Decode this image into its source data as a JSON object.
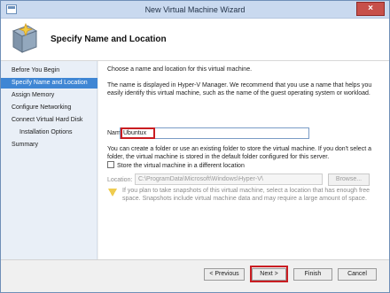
{
  "window": {
    "title": "New Virtual Machine Wizard",
    "close_glyph": "×"
  },
  "header": {
    "title": "Specify Name and Location",
    "icon_name": "virtual-machine-wizard-icon"
  },
  "nav": {
    "items": [
      {
        "label": "Before You Begin"
      },
      {
        "label": "Specify Name and Location"
      },
      {
        "label": "Assign Memory"
      },
      {
        "label": "Configure Networking"
      },
      {
        "label": "Connect Virtual Hard Disk"
      },
      {
        "label": "Installation Options"
      },
      {
        "label": "Summary"
      }
    ]
  },
  "content": {
    "intro": "Choose a name and location for this virtual machine.",
    "description": "The name is displayed in Hyper-V Manager. We recommend that you use a name that helps you easily identify this virtual machine, such as the name of the guest operating system or workload.",
    "name_label": "Name:",
    "name_value": "Ubuntux",
    "folder_text": "You can create a folder or use an existing folder to store the virtual machine. If you don't select a folder, the virtual machine is stored in the default folder configured for this server.",
    "store_label": "Store the virtual machine in a different location",
    "location_label": "Location:",
    "location_value": "C:\\ProgramData\\Microsoft\\Windows\\Hyper-V\\",
    "browse_label": "Browse...",
    "warning_text": "If you plan to take snapshots of this virtual machine, select a location that has enough free space. Snapshots include virtual machine data and may require a large amount of space."
  },
  "buttons": {
    "previous": "< Previous",
    "next": "Next >",
    "finish": "Finish",
    "cancel": "Cancel"
  },
  "colors": {
    "active_nav": "#3f86d4",
    "highlight": "#c91d22"
  }
}
